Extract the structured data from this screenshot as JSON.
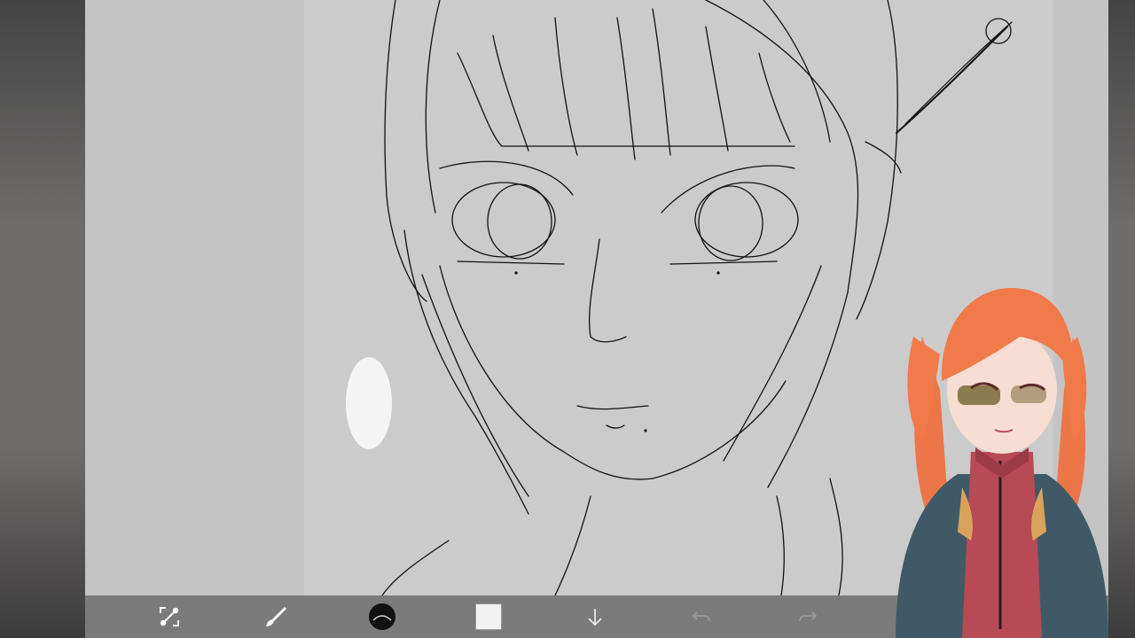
{
  "app": {
    "toolbar": {
      "tools": [
        {
          "name": "transform-tool",
          "icon": "transform-icon"
        },
        {
          "name": "brush-tool",
          "icon": "brush-icon"
        },
        {
          "name": "brush-size-preview",
          "icon": "brush-preview-icon"
        },
        {
          "name": "color-swatch",
          "icon": "color-swatch",
          "color": "#f2f2f2"
        },
        {
          "name": "layer-menu",
          "icon": "arrow-down-icon"
        },
        {
          "name": "undo-button",
          "icon": "undo-icon"
        },
        {
          "name": "redo-button",
          "icon": "redo-icon"
        }
      ]
    },
    "colors": {
      "toolbar_bg": "#7b7b7b",
      "canvas_bg": "#c4c4c4",
      "line_color": "#111111",
      "avatar_hair": "#f07a4a",
      "avatar_suit": "#3f5a66",
      "avatar_accent": "#b84a55"
    }
  }
}
